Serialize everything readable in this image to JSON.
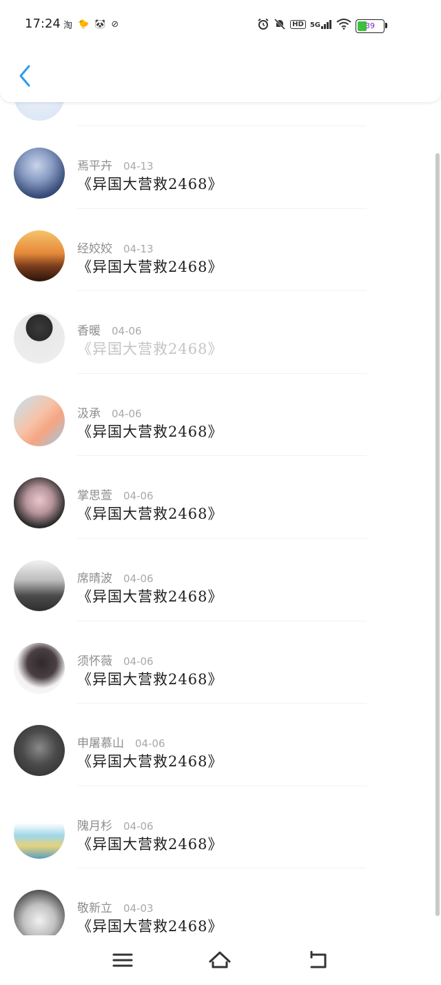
{
  "status_bar": {
    "time": "17:24",
    "app_icons": [
      "淘",
      "🐤",
      "🐼",
      "⊘"
    ],
    "icons": [
      "alarm-icon",
      "bell-off-icon",
      "hd-icon",
      "5g-signal-icon",
      "wifi-icon"
    ],
    "hd_label": "HD",
    "network_label": "5G",
    "battery_percent": 39,
    "battery_label": "39"
  },
  "header": {
    "back_icon": "chevron-left-icon",
    "accent": "#2a9bf0"
  },
  "list": {
    "items": [
      {
        "name": "焉平卉",
        "date": "04-13",
        "title": "《异国大营救2468》",
        "faded": false
      },
      {
        "name": "经姣姣",
        "date": "04-13",
        "title": "《异国大营救2468》",
        "faded": false
      },
      {
        "name": "香暖",
        "date": "04-06",
        "title": "《异国大营救2468》",
        "faded": true
      },
      {
        "name": "汲承",
        "date": "04-06",
        "title": "《异国大营救2468》",
        "faded": false
      },
      {
        "name": "掌思萱",
        "date": "04-06",
        "title": "《异国大营救2468》",
        "faded": false
      },
      {
        "name": "席晴波",
        "date": "04-06",
        "title": "《异国大营救2468》",
        "faded": false
      },
      {
        "name": "须怀薇",
        "date": "04-06",
        "title": "《异国大营救2468》",
        "faded": false
      },
      {
        "name": "申屠慕山",
        "date": "04-06",
        "title": "《异国大营救2468》",
        "faded": false
      },
      {
        "name": "隗月杉",
        "date": "04-06",
        "title": "《异国大营救2468》",
        "faded": false
      },
      {
        "name": "敬新立",
        "date": "04-03",
        "title": "《异国大营救2468》",
        "faded": false
      }
    ]
  },
  "nav_bar": {
    "icons": [
      "menu-icon",
      "home-icon",
      "back-icon"
    ]
  }
}
